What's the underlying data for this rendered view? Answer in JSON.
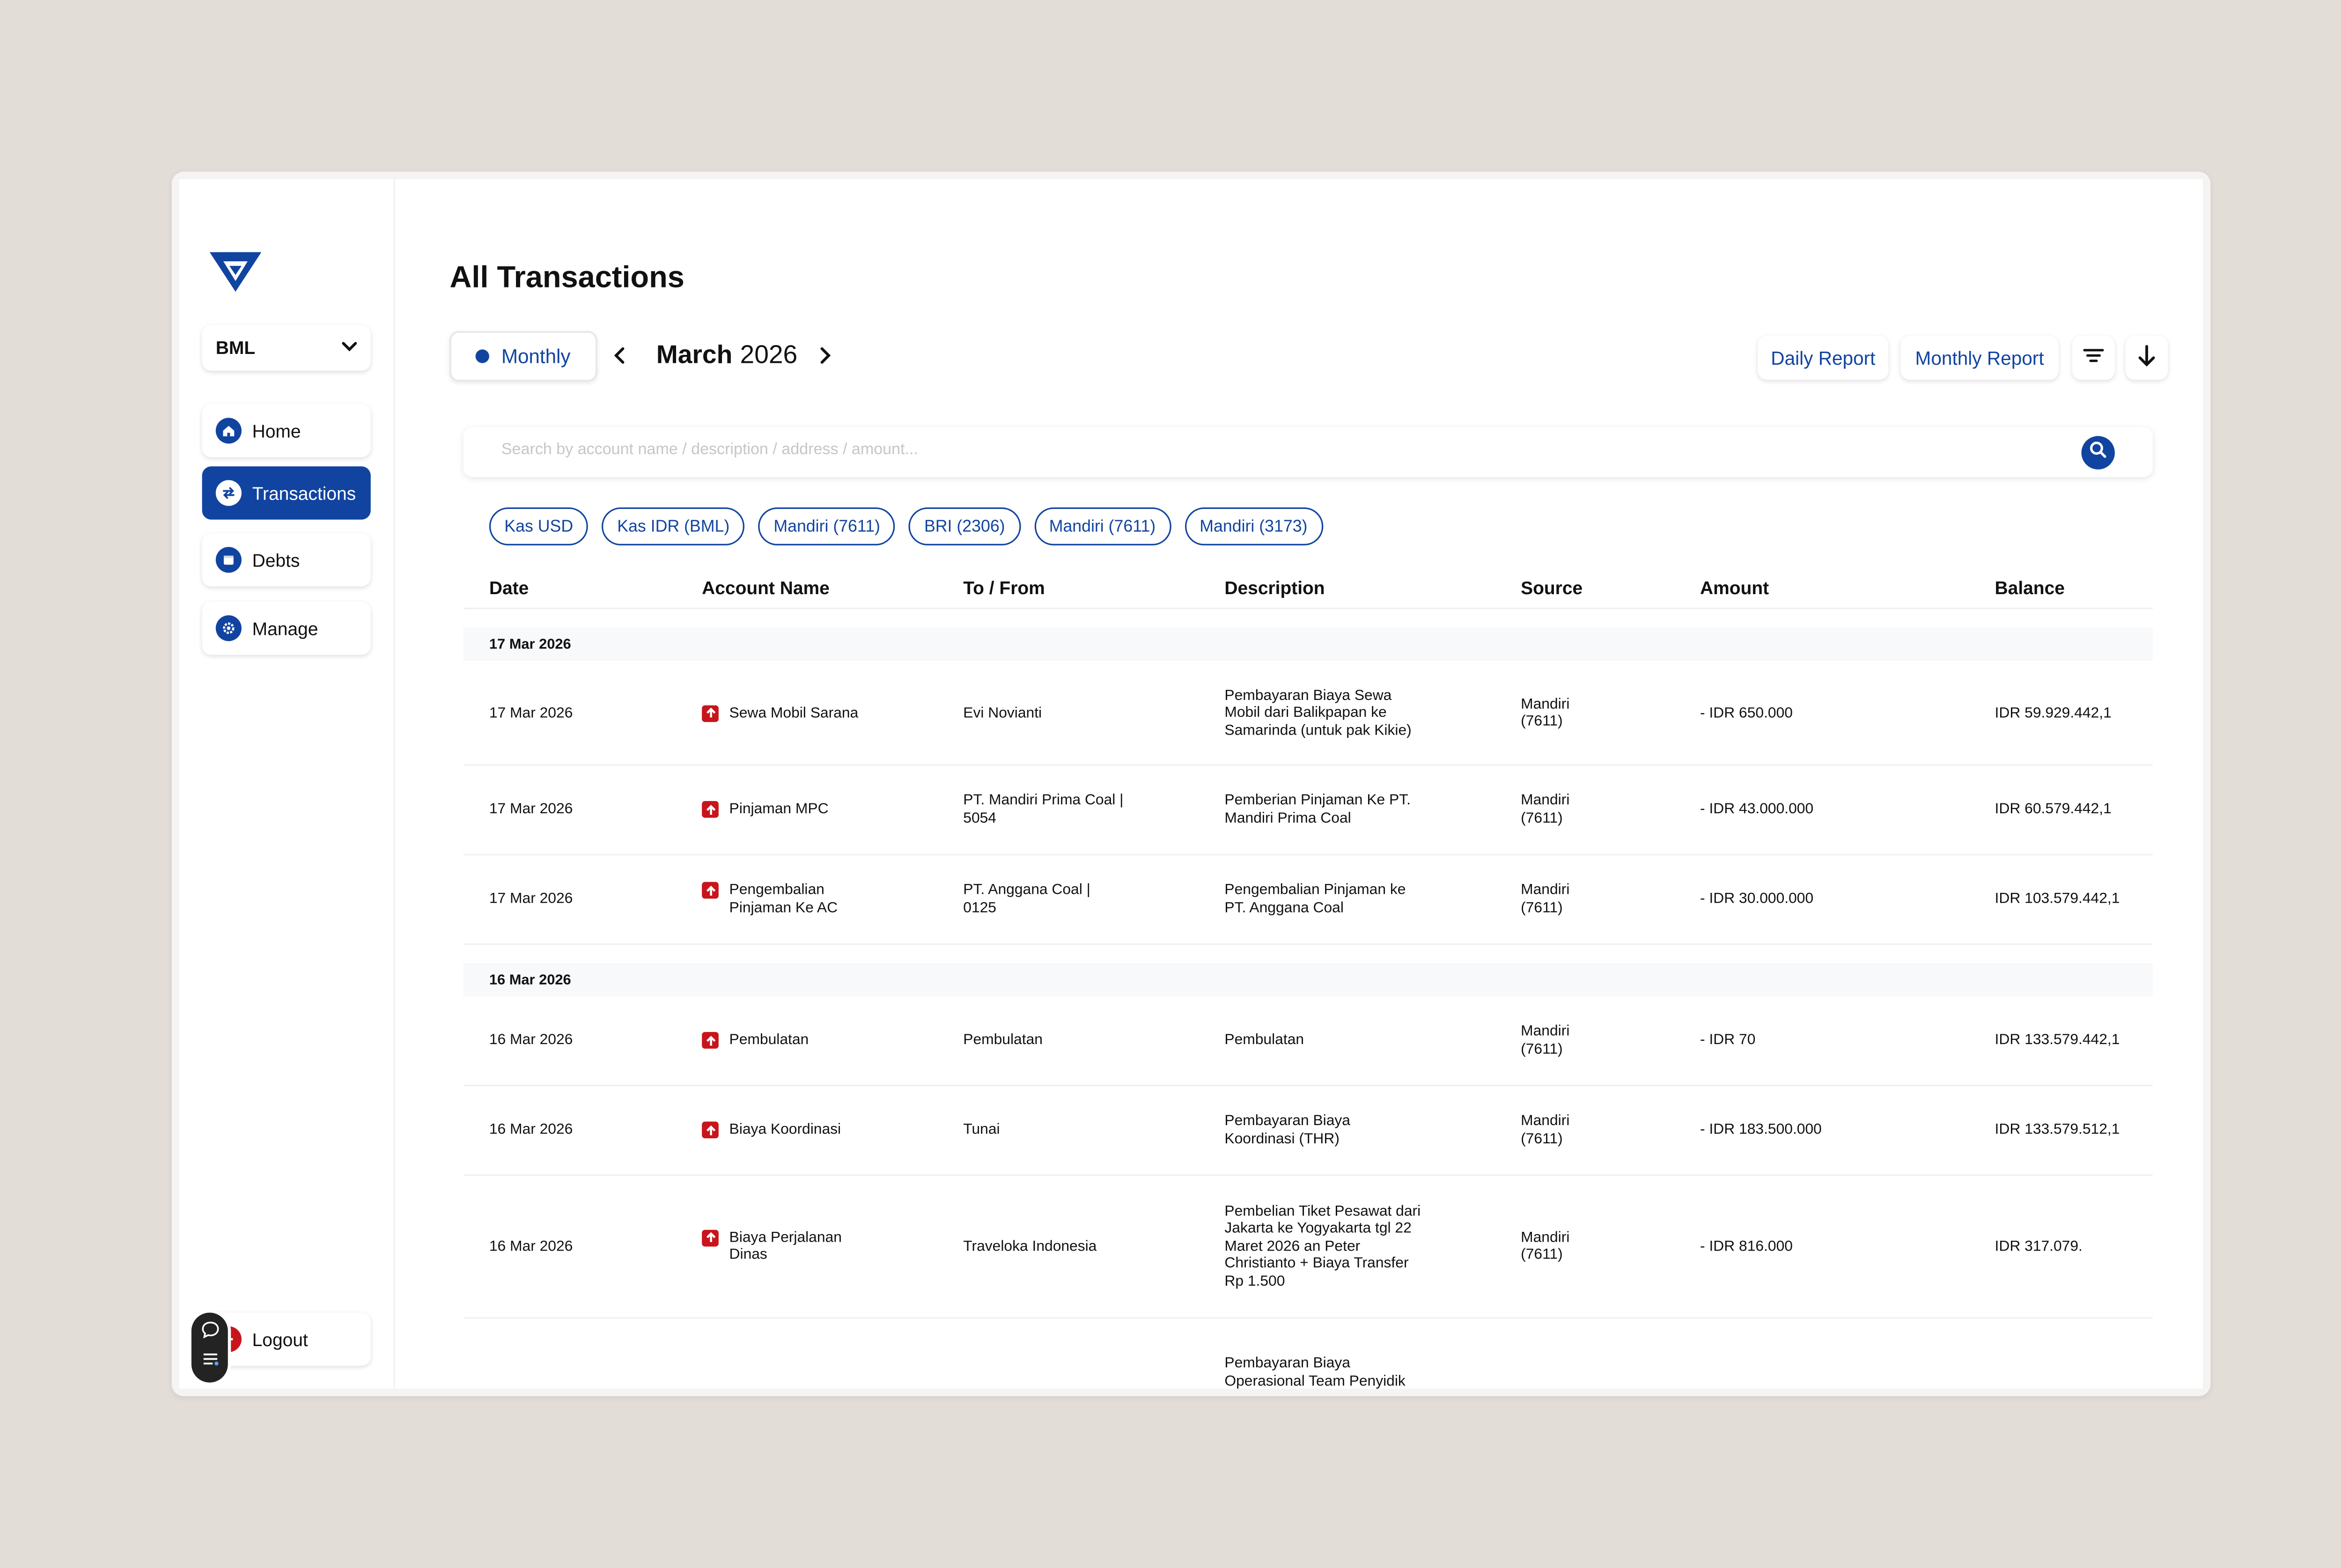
{
  "sidebar": {
    "company": "BML",
    "nav": [
      {
        "label": "Home",
        "icon": "home-icon"
      },
      {
        "label": "Transactions",
        "icon": "transfer-icon"
      },
      {
        "label": "Debts",
        "icon": "wallet-icon"
      },
      {
        "label": "Manage",
        "icon": "gear-icon"
      }
    ],
    "logout": "Logout"
  },
  "header": {
    "title": "All Transactions",
    "view_mode": "Monthly",
    "month": "March",
    "year": "2026",
    "daily_report": "Daily Report",
    "monthly_report": "Monthly Report"
  },
  "search": {
    "placeholder": "Search by account name / description / address / amount..."
  },
  "chips": [
    "Kas USD",
    "Kas IDR (BML)",
    "Mandiri (7611)",
    "BRI (2306)",
    "Mandiri (7611)",
    "Mandiri (3173)"
  ],
  "table": {
    "columns": [
      "Date",
      "Account Name",
      "To / From",
      "Description",
      "Source",
      "Amount",
      "Balance"
    ],
    "groups": [
      {
        "date": "17 Mar 2026",
        "rows": [
          {
            "date": "17 Mar 2026",
            "account": "Sewa Mobil Sarana",
            "to_from": "Evi Novianti",
            "description": "Pembayaran Biaya Sewa Mobil dari Balikpapan ke Samarinda (untuk pak Kikie)",
            "source": "Mandiri (7611)",
            "amount": "- IDR 650.000",
            "balance": "IDR 59.929.442,1"
          },
          {
            "date": "17 Mar 2026",
            "account": "Pinjaman MPC",
            "to_from": "PT. Mandiri Prima Coal | 5054",
            "description": "Pemberian Pinjaman Ke PT. Mandiri Prima Coal",
            "source": "Mandiri (7611)",
            "amount": "- IDR 43.000.000",
            "balance": "IDR 60.579.442,1"
          },
          {
            "date": "17 Mar 2026",
            "account": "Pengembalian Pinjaman Ke AC",
            "to_from": "PT. Anggana Coal | 0125",
            "description": "Pengembalian Pinjaman ke PT. Anggana Coal",
            "source": "Mandiri (7611)",
            "amount": "- IDR 30.000.000",
            "balance": "IDR 103.579.442,1"
          }
        ]
      },
      {
        "date": "16 Mar 2026",
        "rows": [
          {
            "date": "16 Mar 2026",
            "account": "Pembulatan",
            "to_from": "Pembulatan",
            "description": "Pembulatan",
            "source": "Mandiri (7611)",
            "amount": "- IDR 70",
            "balance": "IDR 133.579.442,1"
          },
          {
            "date": "16 Mar 2026",
            "account": "Biaya Koordinasi",
            "to_from": "Tunai",
            "description": "Pembayaran Biaya Koordinasi (THR)",
            "source": "Mandiri (7611)",
            "amount": "- IDR 183.500.000",
            "balance": "IDR 133.579.512,1"
          },
          {
            "date": "16 Mar 2026",
            "account": "Biaya Perjalanan Dinas",
            "to_from": "Traveloka Indonesia",
            "description": "Pembelian Tiket Pesawat dari Jakarta ke Yogyakarta tgl 22 Maret 2026 an Peter Christianto + Biaya Transfer Rp 1.500",
            "source": "Mandiri (7611)",
            "amount": "- IDR 816.000",
            "balance": "IDR 317.079."
          },
          {
            "date": "",
            "account": "",
            "to_from": "",
            "description": "Pembayaran Biaya Operasional Team Penyidik",
            "source": "",
            "amount": "",
            "balance": ""
          }
        ]
      }
    ]
  },
  "colors": {
    "primary": "#1144a0",
    "danger": "#c8151b",
    "background": "#e3ddd7"
  }
}
